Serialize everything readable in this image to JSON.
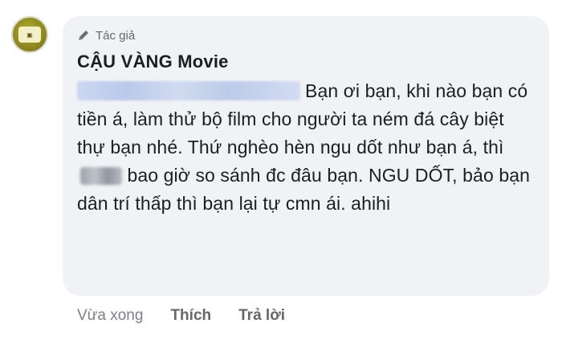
{
  "comment": {
    "author_badge": "Tác giả",
    "author_name": "CẬU VÀNG Movie",
    "body_line_1": "Bạn ơi bạn, khi nào",
    "body_rest_1": "bạn có tiền á, làm thử bộ film cho người ta ném đá cây biệt thự bạn nhé. Thứ nghèo hèn ngu dốt như bạn á, thì",
    "body_rest_2": "bao giờ so sánh đc đâu bạn. NGU DỐT, bảo bạn dân trí thấp thì bạn lại tự cmn ái. ahihi"
  },
  "footer": {
    "time": "Vừa xong",
    "like": "Thích",
    "reply": "Trả lời"
  },
  "colors": {
    "bubble_bg": "#f0f2f5",
    "text": "#1c1e21",
    "meta": "#65676b",
    "avatar": "#8d8720"
  },
  "icons": {
    "author_badge": "pen-icon",
    "avatar": "avatar-logo"
  }
}
